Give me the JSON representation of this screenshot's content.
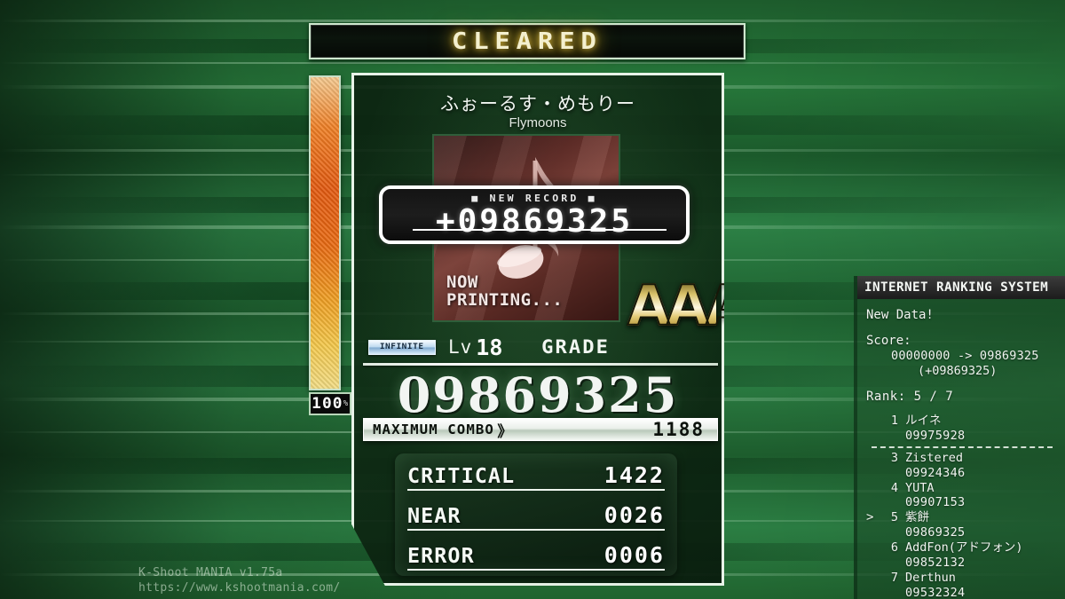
{
  "result": {
    "status_banner": "CLEARED",
    "song": {
      "title": "ふぉーるす・めもりー",
      "artist": "Flymoons"
    },
    "jacket": {
      "caption": "NOW\nPRINTING...",
      "caption_line1": "NOW",
      "caption_line2": "PRINTING...",
      "note_icon": "eighth-note-icon"
    },
    "new_record": {
      "label": "■ NEW RECORD ■",
      "value": "+09869325"
    },
    "difficulty": {
      "badge": "INFINITE",
      "level_label": "Lv",
      "level_value": "18"
    },
    "grade": {
      "label": "GRADE",
      "value": "AAA"
    },
    "score": "09869325",
    "max_combo": {
      "label": "MAXIMUM COMBO",
      "arrow": "》",
      "value": "1188"
    },
    "judgements": [
      {
        "name": "CRITICAL",
        "count": "1422"
      },
      {
        "name": "NEAR",
        "count": "0026"
      },
      {
        "name": "ERROR",
        "count": "0006"
      }
    ],
    "gauge": {
      "percent": "100",
      "percent_sign": "%"
    }
  },
  "internet_ranking": {
    "title": "INTERNET RANKING SYSTEM",
    "status": "New Data!",
    "score_label": "Score:",
    "score_change": "00000000 -> 09869325",
    "score_delta": "(+09869325)",
    "rank_text": "Rank: 5 / 7",
    "entries": [
      {
        "cursor": "",
        "rank": "1",
        "name": "ルイネ",
        "score": "09975928",
        "divider_after": true
      },
      {
        "cursor": "",
        "rank": "3",
        "name": "Zistered",
        "score": "09924346",
        "divider_after": false
      },
      {
        "cursor": "",
        "rank": "4",
        "name": "YUTA",
        "score": "09907153",
        "divider_after": false
      },
      {
        "cursor": ">",
        "rank": "5",
        "name": "紫餅",
        "score": "09869325",
        "divider_after": false
      },
      {
        "cursor": "",
        "rank": "6",
        "name": "AddFon(アドフォン)",
        "score": "09852132",
        "divider_after": false
      },
      {
        "cursor": "",
        "rank": "7",
        "name": "Derthun",
        "score": "09532324",
        "divider_after": false
      }
    ]
  },
  "watermark": {
    "app": "K-Shoot MANIA v1.75a",
    "url": "https://www.kshootmania.com/"
  },
  "colors": {
    "background_green": "#1e6230",
    "cleared_gold": "#f4f0cf",
    "gauge_orange": "#e35a10",
    "grade_gold": "#d9c26a",
    "panel_border": "#e8f3e8"
  }
}
